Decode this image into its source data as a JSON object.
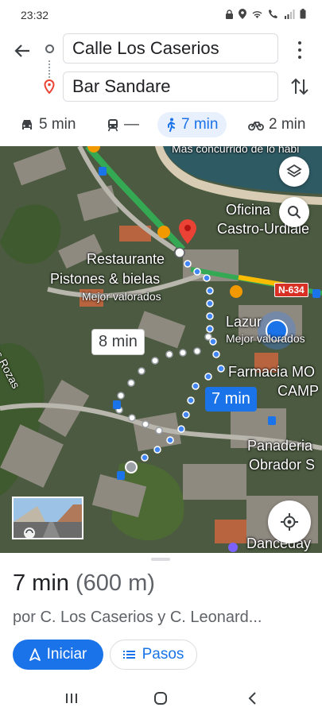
{
  "status_bar": {
    "time": "23:32",
    "icons": [
      "lock-icon",
      "location-icon",
      "wifi-icon",
      "call-icon",
      "signal-icon",
      "battery-icon"
    ]
  },
  "route": {
    "origin": "Calle Los Caserios",
    "destination": "Bar Sandare"
  },
  "modes": [
    {
      "icon": "car-icon",
      "label": "5 min",
      "selected": false
    },
    {
      "icon": "transit-icon",
      "label": "—",
      "selected": false
    },
    {
      "icon": "walk-icon",
      "label": "7 min",
      "selected": true
    },
    {
      "icon": "bike-icon",
      "label": "2 min",
      "selected": false
    }
  ],
  "map": {
    "labels": {
      "top_place": "Mas concurrido de lo habi",
      "oficina": "Oficina",
      "castro": "Castro-Urdiale",
      "restaurante": "Restaurante",
      "pistones": "Pistones & bielas",
      "mejor1": "Mejor valorados",
      "road_shield": "N-634",
      "lazur": "Lazur",
      "mejor2": "Mejor valorados",
      "rozas": "o - las Rozas",
      "farmacia": "Farmacia MO",
      "camp": "CAMP",
      "panaderia": "Panaderia",
      "obrador": "Obrador S",
      "danceday": "Danceday"
    },
    "alt_route_time": "8 min",
    "main_route_time": "7 min",
    "colors": {
      "route": "#1a73e8",
      "traffic_green": "#34a853",
      "pin_red": "#ea4335"
    }
  },
  "sheet": {
    "duration": "7 min",
    "distance": "(600 m)",
    "via": "por C. Los Caserios y C. Leonard...",
    "start_label": "Iniciar",
    "steps_label": "Pasos"
  }
}
